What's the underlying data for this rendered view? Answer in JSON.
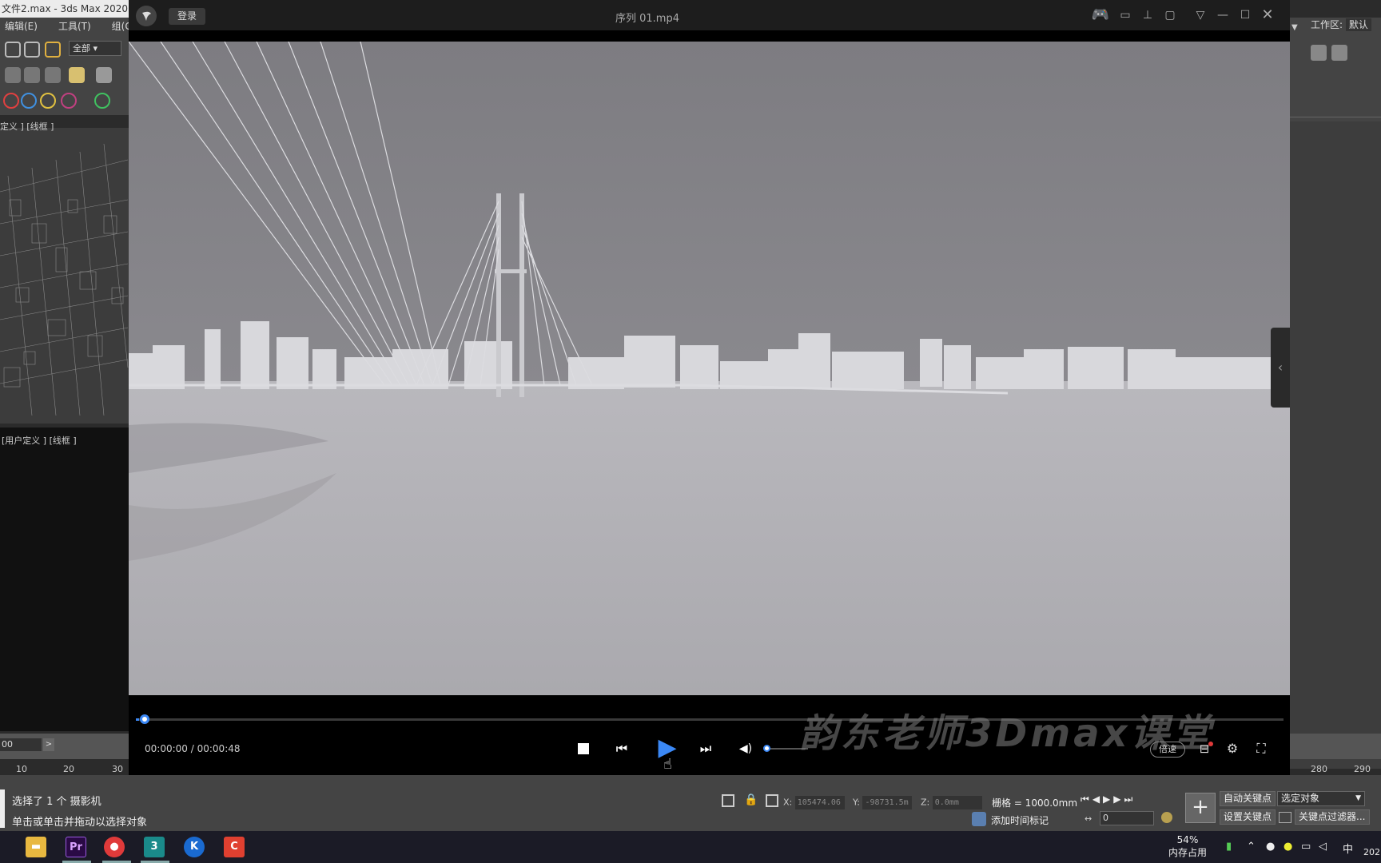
{
  "max": {
    "title": "文件2.max - 3ds Max 2020",
    "menu": [
      "编辑(E)",
      "工具(T)",
      "组(G"
    ],
    "dropdown_all": "全部",
    "workarea_label": "工作区:",
    "workarea_value": "默认",
    "viewport_top_label": "定义 ] [线框 ]",
    "viewport_bottom_label": "[用户定义 ] [线框 ]",
    "frame_field": "00",
    "timeline_ticks_left": [
      "10",
      "20",
      "30"
    ],
    "timeline_ticks_right": [
      "280",
      "290"
    ],
    "status_line1": "选择了 1 个 摄影机",
    "status_line2": "单击或单击并拖动以选择对象",
    "coord_x_label": "X:",
    "coord_x": "105474.06",
    "coord_y_label": "Y:",
    "coord_y": "-98731.5m",
    "coord_z_label": "Z:",
    "coord_z": "0.0mm",
    "grid": "栅格 = 1000.0mm",
    "add_time_tag": "添加时间标记",
    "frame_spinner": "0",
    "auto_key": "自动关键点",
    "selected_object": "选定对象",
    "set_key": "设置关键点",
    "key_filters": "关键点过滤器..."
  },
  "taskbar": {
    "apps": [
      "文件资源管理器",
      "Pr",
      "录屏",
      "3ds Max",
      "K",
      "C"
    ],
    "memory_percent": "54%",
    "memory_label": "内存占用",
    "ime": "中",
    "year_partial": "202"
  },
  "player": {
    "login": "登录",
    "filename": "序列 01.mp4",
    "current_time": "00:00:00",
    "separator": "/",
    "total_time": "00:00:48",
    "progress": 0.003,
    "volume": 0.1,
    "speed_label": "倍速",
    "watermark": "韵东老师3Dmax课堂",
    "state": "paused"
  },
  "colors": {
    "accent": "#3b88f5",
    "sky": "#7f7e83",
    "water": "#aeadb2"
  }
}
